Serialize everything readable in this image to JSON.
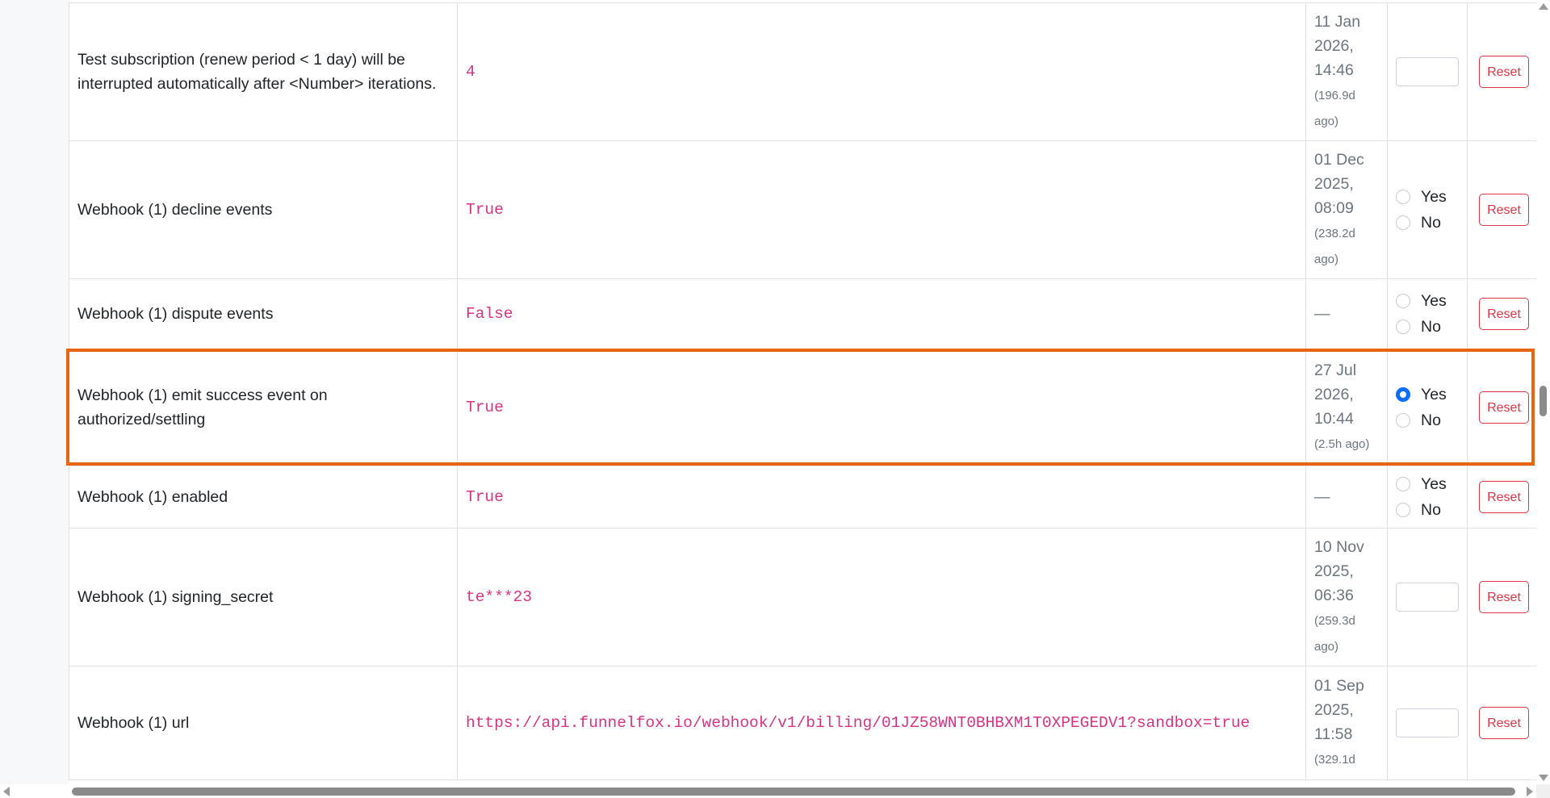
{
  "settings": {
    "rows": [
      {
        "name": "Test subscription (renew period < 1 day) will be interrupted automatically after <Number> iterations.",
        "value": "4",
        "updated_date": "11 Jan 2026, 14:46",
        "updated_ago": "(196.9d ago)",
        "control_type": "number",
        "reset_label": "Reset"
      },
      {
        "name": "Webhook (1) decline events",
        "value": "True",
        "updated_date": "01 Dec 2025, 08:09",
        "updated_ago": "(238.2d ago)",
        "control_type": "yes-no",
        "yes_label": "Yes",
        "no_label": "No",
        "selected": null,
        "reset_label": "Reset"
      },
      {
        "name": "Webhook (1) dispute events",
        "value": "False",
        "updated_date": "—",
        "updated_ago": "",
        "control_type": "yes-no",
        "yes_label": "Yes",
        "no_label": "No",
        "selected": null,
        "reset_label": "Reset"
      },
      {
        "name": "Webhook (1) emit success event on authorized/settling",
        "value": "True",
        "updated_date": "27 Jul 2026, 10:44",
        "updated_ago": "(2.5h ago)",
        "control_type": "yes-no",
        "yes_label": "Yes",
        "no_label": "No",
        "selected": "Yes",
        "highlighted": true,
        "reset_label": "Reset"
      },
      {
        "name": "Webhook (1) enabled",
        "value": "True",
        "updated_date": "—",
        "updated_ago": "",
        "control_type": "yes-no",
        "yes_label": "Yes",
        "no_label": "No",
        "selected": null,
        "reset_label": "Reset"
      },
      {
        "name": "Webhook (1) signing_secret",
        "value": "te***23",
        "updated_date": "10 Nov 2025, 06:36",
        "updated_ago": "(259.3d ago)",
        "control_type": "text",
        "reset_label": "Reset"
      },
      {
        "name": "Webhook (1) url",
        "value": "https://api.funnelfox.io/webhook/v1/billing/01JZ58WNT0BHBXM1T0XPEGEDV1?sandbox=true",
        "updated_date": "01 Sep 2025, 11:58",
        "updated_ago": "(329.1d",
        "control_type": "text",
        "reset_label": "Reset"
      }
    ]
  },
  "colors": {
    "value_text": "#d63384",
    "muted_text": "#6c757d",
    "reset_accent": "#dc3545",
    "radio_checked": "#0d6efd",
    "highlight_border": "#e8650f"
  }
}
